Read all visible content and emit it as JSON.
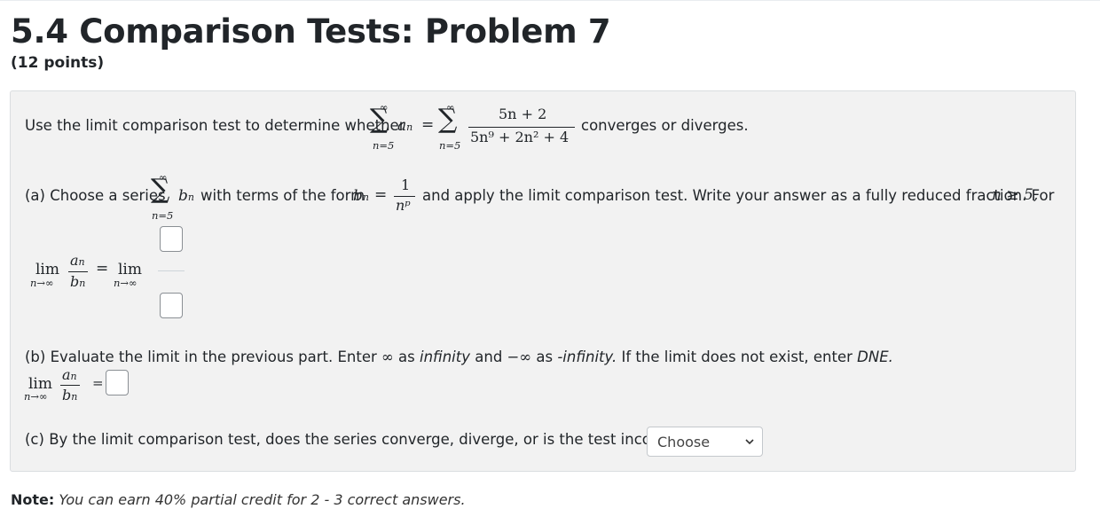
{
  "page": {
    "title": "5.4 Comparison Tests: Problem 7",
    "points": "(12 points)"
  },
  "question": {
    "intro_prefix": "Use the limit comparison test to determine whether",
    "intro_suffix": "converges or diverges.",
    "series_upper": "∞",
    "series_lower": "n=5",
    "series_term": "a",
    "series_term_sub": "n",
    "fraction_numerator": "5n + 2",
    "fraction_denominator": "5n⁹ + 2n² + 4"
  },
  "part_a": {
    "prefix": "(a) Choose a series",
    "mid": "with terms of the form",
    "suffix": "and apply the limit comparison test. Write your answer as a fully reduced fraction. For",
    "condition": "n ≥ 5,",
    "bn_num": "1",
    "bn_den": "nᵖ",
    "lim_label": "lim",
    "lim_sub": "n→∞",
    "numerator_input_value": "",
    "denominator_input_value": ""
  },
  "part_b": {
    "text_1": "(b) Evaluate the limit in the previous part. Enter",
    "infinity_symbol": "∞",
    "text_2": "as",
    "infinity_word": "infinity",
    "text_3": "and",
    "neg_infinity_symbol": "−∞",
    "text_4": "as",
    "neg_infinity_word": "-infinity.",
    "text_5": "If the limit does not exist, enter",
    "dne_word": "DNE.",
    "answer_value": ""
  },
  "part_c": {
    "question": "(c) By the limit comparison test, does the series converge, diverge, or is the test inconclusive?",
    "select_value": "Choose"
  },
  "note": {
    "label": "Note:",
    "text": "You can earn 40% partial credit for 2 - 3 correct answers."
  }
}
